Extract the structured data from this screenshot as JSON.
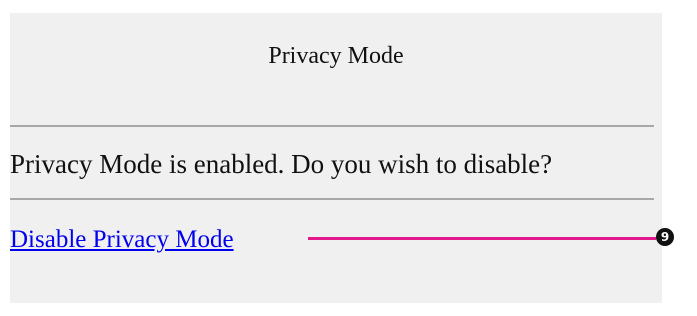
{
  "dialog": {
    "title": "Privacy Mode",
    "message": "Privacy Mode is enabled. Do you wish to disable?",
    "link_label": "Disable Privacy Mode"
  },
  "callout": {
    "number": "9",
    "color": "#e2198a"
  },
  "colors": {
    "panel_background": "#f0f0f0",
    "link": "#0000ee",
    "rule": "#a8a8a8"
  }
}
